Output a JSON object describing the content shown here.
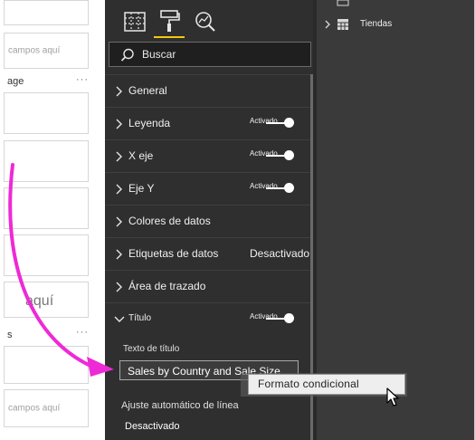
{
  "left_pane": {
    "well_placeholder_1": "campos aquí",
    "section_label_1": "age",
    "section_dots": "···",
    "well_placeholder_2": "aquí",
    "section_label_2": "s",
    "well_placeholder_3": "campos aquí"
  },
  "format_pane": {
    "tabs": [
      {
        "name": "fields-tab",
        "icon": "table-grid-icon"
      },
      {
        "name": "format-tab",
        "icon": "paint-roller-icon",
        "active": true
      },
      {
        "name": "analytics-tab",
        "icon": "magnifier-chart-icon"
      }
    ],
    "search_label": "Buscar",
    "cards": [
      {
        "label": "General",
        "expanded": false
      },
      {
        "label": "Leyenda",
        "expanded": false,
        "toggle": "Activado"
      },
      {
        "label": "X eje",
        "expanded": false,
        "toggle": "Activado"
      },
      {
        "label": "Eje Y",
        "expanded": false,
        "toggle": "Activado"
      },
      {
        "label": "Colores de datos",
        "expanded": false
      },
      {
        "label": "Etiquetas de datos",
        "expanded": false,
        "state": "Desactivado"
      },
      {
        "label": "Área de trazado",
        "expanded": false
      },
      {
        "label": "Título",
        "expanded": true,
        "toggle": "Activado"
      }
    ],
    "title_section": {
      "text_label": "Texto de título",
      "title_value": "Sales by Country and Sale Size",
      "wrap_label": "Ajuste automático de línea",
      "wrap_state": "Desactivado"
    }
  },
  "fields_pane": {
    "tree_item": "Tiendas"
  },
  "context_menu": {
    "item": "Formato condicional"
  },
  "colors": {
    "pane_bg": "#2f2f2f",
    "accent_yellow": "#f2c811",
    "arrow_magenta": "#ee2ad6"
  }
}
